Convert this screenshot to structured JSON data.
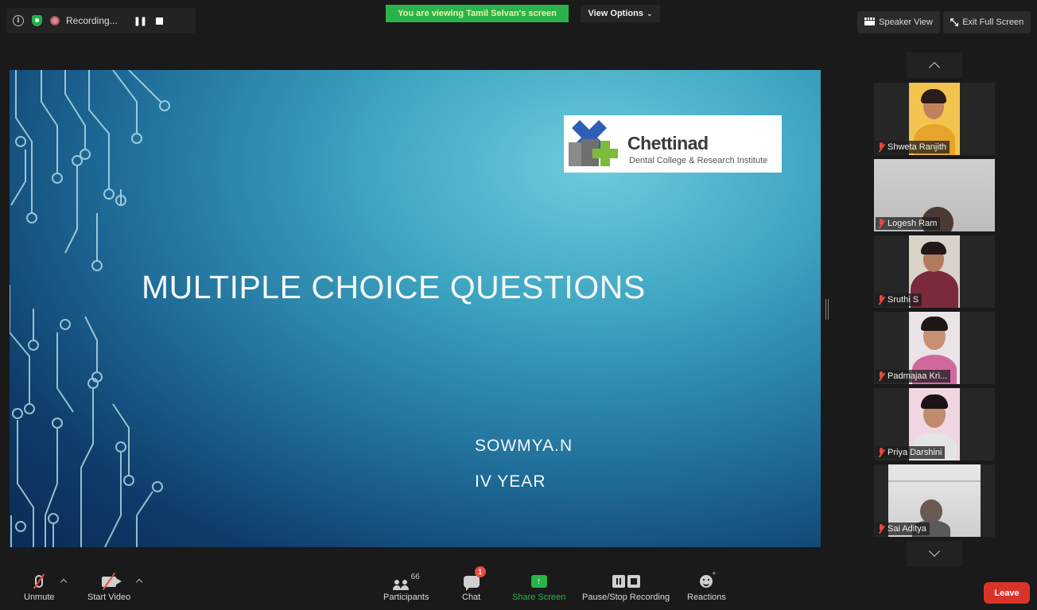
{
  "top_bar": {
    "recording_label": "Recording...",
    "viewing_banner": "You are viewing Tamil Selvan's screen",
    "view_options_label": "View Options",
    "view_options_caret": "⌄",
    "speaker_view_label": "Speaker View",
    "exit_full_screen_label": "Exit Full Screen"
  },
  "shared_slide": {
    "logo_name": "Chettinad",
    "logo_subtitle": "Dental College & Research Institute",
    "title": "MULTIPLE CHOICE QUESTIONS",
    "presenter": "SOWMYA.N",
    "year": "IV YEAR",
    "colors": {
      "bg_light": "#6ecbdc",
      "bg_dark": "#0b2b55",
      "text": "#f4f8fb"
    }
  },
  "participants_strip": {
    "tiles": [
      {
        "name": "Shweta Ranjith",
        "muted": true,
        "video": true
      },
      {
        "name": "Logesh Ram",
        "muted": true,
        "video": true
      },
      {
        "name": "Sruthi S",
        "muted": true,
        "video": true
      },
      {
        "name": "Padmajaa Kri...",
        "muted": true,
        "video": true
      },
      {
        "name": "Priya Darshini",
        "muted": true,
        "video": true
      },
      {
        "name": "Sai Aditya",
        "muted": true,
        "video": true
      }
    ],
    "scroll_up_icon": "chevron-up-icon",
    "scroll_down_icon": "chevron-down-icon"
  },
  "toolbar": {
    "unmute_label": "Unmute",
    "start_video_label": "Start Video",
    "participants_label": "Participants",
    "participants_count": "66",
    "chat_label": "Chat",
    "chat_badge": "1",
    "share_screen_label": "Share Screen",
    "share_screen_glyph": "↑",
    "pause_stop_label": "Pause/Stop Recording",
    "reactions_label": "Reactions",
    "reactions_plus": "+",
    "leave_label": "Leave",
    "colors": {
      "share_green": "#29b34a",
      "leave_red": "#d9342a",
      "muted_red": "#e64a3d"
    }
  }
}
